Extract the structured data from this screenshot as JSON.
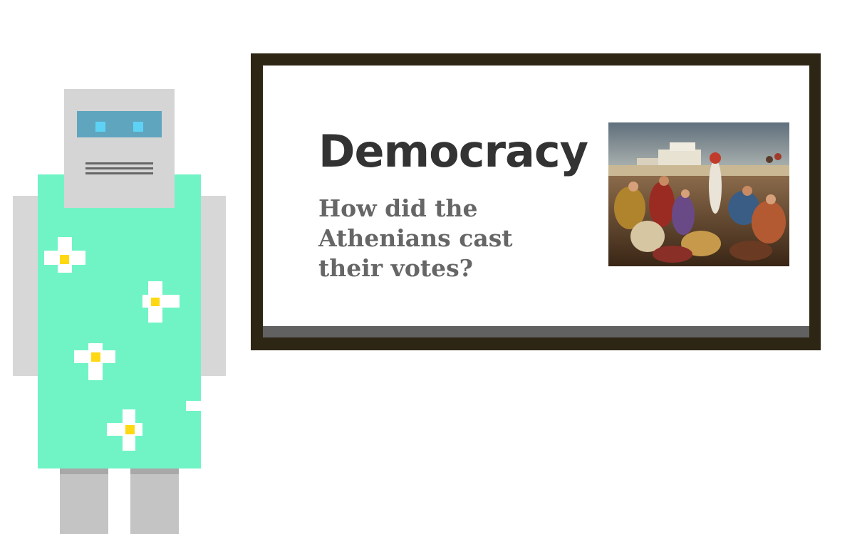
{
  "board": {
    "title": "Democracy",
    "subtitle": "How did the Athenians cast their votes?",
    "image_icon": "painting-icon"
  },
  "robot": {
    "icon": "robot-icon",
    "colors": {
      "head": "#d5d5d5",
      "visor": "#5fa5be",
      "eyes": "#5ed2f5",
      "dress": "#70f4c5",
      "flower_petals": "#ffffff",
      "flower_center": "#ffd814"
    }
  },
  "colors": {
    "frame": "#2e2615",
    "title": "#333333",
    "subtitle": "#666666",
    "board_bottom": "#616161"
  }
}
